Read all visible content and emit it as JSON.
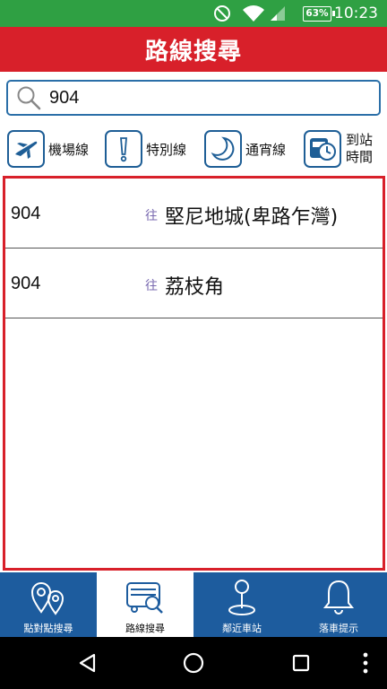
{
  "status_bar": {
    "battery_text": "63%",
    "time": "10:23"
  },
  "header": {
    "title": "路線搜尋"
  },
  "search": {
    "value": "904"
  },
  "categories": [
    {
      "label": "機場線",
      "icon": "airplane-icon"
    },
    {
      "label": "特別線",
      "icon": "exclamation-icon"
    },
    {
      "label": "通宵線",
      "icon": "moon-icon"
    },
    {
      "label_line1": "到站",
      "label_line2": "時間",
      "icon": "bus-clock-icon"
    }
  ],
  "results": {
    "to_label": "往",
    "rows": [
      {
        "route": "904",
        "destination": "堅尼地城(卑路乍灣)"
      },
      {
        "route": "904",
        "destination": "荔枝角"
      }
    ]
  },
  "bottom_nav": [
    {
      "label": "點對點搜尋",
      "icon": "map-pins-icon",
      "active": false
    },
    {
      "label": "路線搜尋",
      "icon": "bus-search-icon",
      "active": true
    },
    {
      "label": "鄰近車站",
      "icon": "location-pin-icon",
      "active": false
    },
    {
      "label": "落車提示",
      "icon": "bell-icon",
      "active": false
    }
  ],
  "colors": {
    "status_bar": "#2fa043",
    "title_bar": "#d8202a",
    "accent_blue": "#1d5c9e",
    "results_border": "#d8202a"
  }
}
